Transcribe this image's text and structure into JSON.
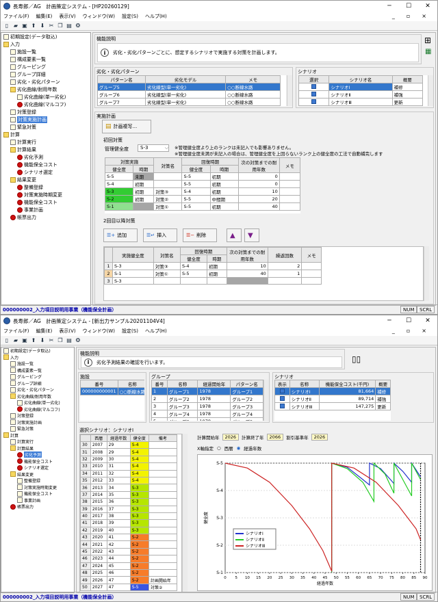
{
  "w1": {
    "title": "長寿郎／AG　計画策定システム - [HP20260129]",
    "menus": [
      "ファイル(F)",
      "編集(E)",
      "表示(V)",
      "ウィンドウ(W)",
      "設定(S)",
      "ヘルプ(H)"
    ],
    "tree": [
      {
        "label": "初期設定(データ取込)",
        "lvl": 0,
        "ic": "d"
      },
      {
        "label": "入力",
        "lvl": 0,
        "ic": "f"
      },
      {
        "label": "施設一覧",
        "lvl": 1,
        "ic": "d"
      },
      {
        "label": "構成要素一覧",
        "lvl": 1,
        "ic": "d"
      },
      {
        "label": "グルーピング",
        "lvl": 1,
        "ic": "d"
      },
      {
        "label": "グループ詳細",
        "lvl": 1,
        "ic": "d"
      },
      {
        "label": "劣化・劣化パターン",
        "lvl": 1,
        "ic": "d"
      },
      {
        "label": "劣化曲線/耐用年数",
        "lvl": 1,
        "ic": "f"
      },
      {
        "label": "劣化曲線(単一劣化)",
        "lvl": 2,
        "ic": "d"
      },
      {
        "label": "劣化曲線(マルコフ)",
        "lvl": 2,
        "ic": "r"
      },
      {
        "label": "対策登録",
        "lvl": 1,
        "ic": "d"
      },
      {
        "label": "対策実施計画",
        "lvl": 1,
        "ic": "d",
        "sel": true
      },
      {
        "label": "緊急対策",
        "lvl": 1,
        "ic": "d"
      },
      {
        "label": "計算",
        "lvl": 0,
        "ic": "f"
      },
      {
        "label": "計算実行",
        "lvl": 1,
        "ic": "d"
      },
      {
        "label": "計算結果",
        "lvl": 1,
        "ic": "f"
      },
      {
        "label": "劣化予測",
        "lvl": 2,
        "ic": "r"
      },
      {
        "label": "機能保全コスト",
        "lvl": 2,
        "ic": "r"
      },
      {
        "label": "シナリオ選定",
        "lvl": 2,
        "ic": "r"
      },
      {
        "label": "結果変更",
        "lvl": 1,
        "ic": "f"
      },
      {
        "label": "整備登録",
        "lvl": 2,
        "ic": "r"
      },
      {
        "label": "対策実施時期変更",
        "lvl": 2,
        "ic": "r"
      },
      {
        "label": "機能保全コスト",
        "lvl": 2,
        "ic": "r"
      },
      {
        "label": "事業計画",
        "lvl": 2,
        "ic": "r"
      },
      {
        "label": "帳票出力",
        "lvl": 1,
        "ic": "r"
      }
    ],
    "desc_title": "機能説明",
    "desc_text": "劣化・劣化パターンごとに、想定するシナリオで実施する対策を計画します。",
    "pattern": {
      "title": "劣化・劣化パターン",
      "headers": [
        "パターン名",
        "劣化モデル",
        "メモ"
      ],
      "rows": [
        [
          "グループ5",
          "劣化線型(単一劣化)",
          "○○断線水路"
        ],
        [
          "グループ6",
          "劣化線型(単一劣化)",
          "○○断線水路"
        ],
        [
          "グループ7",
          "劣化線型(単一劣化)",
          "○○断線水路"
        ]
      ]
    },
    "scenario": {
      "title": "シナリオ",
      "headers": [
        "選択",
        "シナリオ名",
        "概要"
      ],
      "rows": [
        [
          "シナリオⅠ",
          "補修"
        ],
        [
          "シナリオⅡ",
          "補強"
        ],
        [
          "シナリオⅢ",
          "更新"
        ]
      ]
    },
    "plan": {
      "title": "実施計画",
      "copy_btn": "計画複写...",
      "first_title": "初回対策",
      "mgmt_label": "管理健全度",
      "mgmt_value": "S-3",
      "note1": "※管理健全度より上のランクは未記入でも影響ありません。",
      "note2": "※管理健全度未満が未記入の場合は、管理健全度を上回らないランク上の健全度の工法で自動補完します",
      "h1": [
        "対策実施",
        "対策名",
        "回復時期",
        "次の対策までの耐用年数",
        "メモ"
      ],
      "h2": [
        "健全度",
        "時期",
        "健全度",
        "時期"
      ],
      "rows": [
        [
          "S-5",
          "未期",
          "",
          "S-5",
          "初期",
          "0"
        ],
        [
          "S-4",
          "初期",
          "",
          "S-5",
          "初期",
          "0"
        ],
        [
          "S-3",
          "初期",
          "対策③",
          "S-4",
          "初期",
          "10"
        ],
        [
          "S-2",
          "初期",
          "対策②",
          "S-5",
          "中間期",
          "20"
        ],
        [
          "S-1",
          "",
          "対策①",
          "S-5",
          "初期",
          "40"
        ]
      ],
      "second_title": "2回目以降対策",
      "btn_add": "追加",
      "btn_insert": "挿入",
      "btn_delete": "削除",
      "h2nd": [
        "実施健全度",
        "対策名",
        "回復時期",
        "次の対策までの耐用年数",
        "繰返回数",
        "メモ"
      ],
      "h2nd_sub": [
        "健全度",
        "時期"
      ],
      "rows2": [
        [
          "1",
          "S-3",
          "対策③",
          "S-4",
          "初期",
          "10",
          "2"
        ],
        [
          "2",
          "S-1",
          "対策①",
          "S-5",
          "初期",
          "40",
          "1"
        ],
        [
          "3",
          "S-3",
          "",
          "",
          "",
          "",
          ""
        ]
      ]
    },
    "status": "000000002_入力項目説明用事業（機能保全計画）",
    "num": "NUM",
    "scrl": "SCRL"
  },
  "w2": {
    "title": "長寿郎／AG　計画策定システム - [新出力サンプル20201104V4]",
    "menus": [
      "ファイル(F)",
      "編集(E)",
      "表示(V)",
      "ウィンドウ(W)",
      "設定(S)",
      "ヘルプ(H)"
    ],
    "tree": [
      {
        "label": "初期設定(データ取込)",
        "lvl": 0,
        "ic": "d"
      },
      {
        "label": "入力",
        "lvl": 0,
        "ic": "f"
      },
      {
        "label": "施設一覧",
        "lvl": 1,
        "ic": "d"
      },
      {
        "label": "構成要素一覧",
        "lvl": 1,
        "ic": "d"
      },
      {
        "label": "グルーピング",
        "lvl": 1,
        "ic": "d"
      },
      {
        "label": "グループ詳細",
        "lvl": 1,
        "ic": "d"
      },
      {
        "label": "劣化・劣化パターン",
        "lvl": 1,
        "ic": "d"
      },
      {
        "label": "劣化曲線/耐用年数",
        "lvl": 1,
        "ic": "f"
      },
      {
        "label": "劣化曲線(単一劣化)",
        "lvl": 2,
        "ic": "d"
      },
      {
        "label": "劣化曲線(マルコフ)",
        "lvl": 2,
        "ic": "r"
      },
      {
        "label": "対策登録",
        "lvl": 1,
        "ic": "d"
      },
      {
        "label": "対策実施計画",
        "lvl": 1,
        "ic": "d"
      },
      {
        "label": "緊急対策",
        "lvl": 1,
        "ic": "d"
      },
      {
        "label": "計算",
        "lvl": 0,
        "ic": "f"
      },
      {
        "label": "計算実行",
        "lvl": 1,
        "ic": "d"
      },
      {
        "label": "計算結果",
        "lvl": 1,
        "ic": "f"
      },
      {
        "label": "劣化予測",
        "lvl": 2,
        "ic": "r",
        "sel": true
      },
      {
        "label": "機能保全コスト",
        "lvl": 2,
        "ic": "r"
      },
      {
        "label": "シナリオ選定",
        "lvl": 2,
        "ic": "r"
      },
      {
        "label": "結果変更",
        "lvl": 1,
        "ic": "f"
      },
      {
        "label": "整備登録",
        "lvl": 2,
        "ic": "d"
      },
      {
        "label": "対策実施時期変更",
        "lvl": 2,
        "ic": "d"
      },
      {
        "label": "機能保全コスト",
        "lvl": 2,
        "ic": "d"
      },
      {
        "label": "事業計画",
        "lvl": 2,
        "ic": "d"
      },
      {
        "label": "帳票出力",
        "lvl": 1,
        "ic": "r"
      }
    ],
    "desc_title": "機能説明",
    "desc_text": "劣化予測結果の確認を行います。",
    "facility": {
      "title": "施設",
      "headers": [
        "番号",
        "名称"
      ],
      "rows": [
        [
          "000000000001",
          "○○断線水路"
        ]
      ]
    },
    "group": {
      "title": "グループ",
      "headers": [
        "番号",
        "名称",
        "経過開始年",
        "パターン名"
      ],
      "rows": [
        [
          "1",
          "グループ1",
          "1978",
          "グループ1"
        ],
        [
          "2",
          "グループ2",
          "1978",
          "グループ2"
        ],
        [
          "3",
          "グループ3",
          "1978",
          "グループ3"
        ],
        [
          "4",
          "グループ4",
          "1978",
          "グループ4"
        ],
        [
          "5",
          "グループ5",
          "1978",
          "グループ5"
        ],
        [
          "6",
          "グループ6",
          "1978",
          "グループ6"
        ]
      ]
    },
    "scen": {
      "title": "シナリオ",
      "headers": [
        "表示",
        "名称",
        "機能保全コスト(千円)",
        "概要"
      ],
      "rows": [
        [
          "シナリオⅠ",
          "81,664",
          "補修"
        ],
        [
          "シナリオⅡ",
          "89,714",
          "補強"
        ],
        [
          "シナリオⅢ",
          "147,275",
          "更新"
        ]
      ]
    },
    "sel_title": "選択シナリオ：シナリオⅠ",
    "yh": [
      "",
      "西暦",
      "経過年数",
      "健全度",
      "備考"
    ],
    "years": [
      [
        "30",
        "2007",
        "29",
        "S-4",
        ""
      ],
      [
        "31",
        "2008",
        "29",
        "S-4",
        ""
      ],
      [
        "32",
        "2009",
        "30",
        "S-4",
        ""
      ],
      [
        "33",
        "2010",
        "31",
        "S-4",
        ""
      ],
      [
        "34",
        "2011",
        "32",
        "S-4",
        ""
      ],
      [
        "35",
        "2012",
        "33",
        "S-4",
        ""
      ],
      [
        "36",
        "2013",
        "34",
        "S-3",
        ""
      ],
      [
        "37",
        "2014",
        "35",
        "S-3",
        ""
      ],
      [
        "38",
        "2015",
        "36",
        "S-3",
        ""
      ],
      [
        "39",
        "2016",
        "37",
        "S-3",
        ""
      ],
      [
        "40",
        "2017",
        "38",
        "S-3",
        ""
      ],
      [
        "41",
        "2018",
        "39",
        "S-3",
        ""
      ],
      [
        "42",
        "2019",
        "40",
        "S-3",
        ""
      ],
      [
        "43",
        "2020",
        "41",
        "S-2",
        ""
      ],
      [
        "44",
        "2021",
        "42",
        "S-2",
        ""
      ],
      [
        "45",
        "2022",
        "43",
        "S-2",
        ""
      ],
      [
        "46",
        "2023",
        "44",
        "S-2",
        ""
      ],
      [
        "47",
        "2024",
        "45",
        "S-2",
        ""
      ],
      [
        "48",
        "2025",
        "46",
        "S-2",
        ""
      ],
      [
        "49",
        "2026",
        "47",
        "S-2",
        "計画開始年"
      ],
      [
        "50",
        "2027",
        "47",
        "S-5",
        "対策②"
      ]
    ],
    "calc": {
      "start_label": "計算開始年",
      "start": "2026",
      "end_label": "計算終了年",
      "end": "2066",
      "rate_label": "割引基準年",
      "rate": "2026"
    },
    "axis_label": "X軸指定",
    "opt1": "西暦",
    "opt2": "経過年数",
    "status": "000000002_入力項目説明用事業（機能保全計画）",
    "num": "NUM",
    "scrl": "SCRL"
  },
  "chart_data": {
    "type": "line",
    "xlabel": "経過年数",
    "ylabel": "健全度",
    "xlim": [
      0,
      90
    ],
    "ylim": [
      1,
      5
    ],
    "xticks": [
      0,
      5,
      10,
      15,
      20,
      25,
      30,
      35,
      40,
      45,
      50,
      55,
      60,
      65,
      70,
      75,
      80,
      85,
      90
    ],
    "yticks": [
      "S-1",
      "S-2",
      "S-3",
      "S-4",
      "S-5"
    ],
    "vlines": [
      {
        "x": 48,
        "color": "#22aa22"
      },
      {
        "x": 88,
        "color": "#000000"
      }
    ],
    "series": [
      {
        "name": "シナリオⅠ",
        "color": "#2233cc",
        "points": [
          [
            48,
            1.05
          ],
          [
            48,
            5
          ],
          [
            55,
            4.85
          ],
          [
            62,
            4.4
          ],
          [
            65,
            4.2
          ],
          [
            65,
            5
          ],
          [
            70,
            4.8
          ],
          [
            75,
            4.35
          ],
          [
            76,
            4.25
          ],
          [
            76,
            5
          ],
          [
            80,
            4.7
          ],
          [
            84,
            4.3
          ],
          [
            84,
            5
          ],
          [
            88,
            4.5
          ]
        ]
      },
      {
        "name": "シナリオⅡ",
        "color": "#22cc22",
        "points": [
          [
            48,
            1.05
          ],
          [
            48,
            5
          ],
          [
            55,
            4.8
          ],
          [
            62,
            4.3
          ],
          [
            67,
            3.6
          ],
          [
            67,
            5
          ],
          [
            72,
            4.6
          ],
          [
            76,
            3.9
          ],
          [
            76,
            5
          ],
          [
            80,
            4.4
          ],
          [
            84,
            3.8
          ],
          [
            84,
            5
          ],
          [
            88,
            4.4
          ]
        ]
      },
      {
        "name": "シナリオⅢ",
        "color": "#cc2222",
        "points": [
          [
            0,
            5
          ],
          [
            10,
            4.82
          ],
          [
            20,
            4.3
          ],
          [
            30,
            3.45
          ],
          [
            38,
            2.6
          ],
          [
            44,
            1.8
          ],
          [
            48,
            1.05
          ],
          [
            48,
            5
          ],
          [
            58,
            4.82
          ],
          [
            68,
            4.3
          ],
          [
            78,
            3.45
          ],
          [
            86,
            2.6
          ],
          [
            88,
            2.2
          ]
        ]
      }
    ]
  }
}
